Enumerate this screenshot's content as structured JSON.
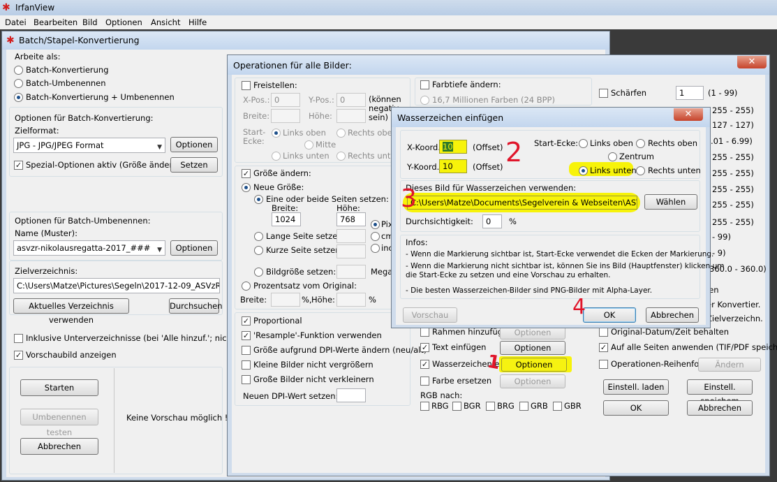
{
  "app": {
    "title": "IrfanView",
    "menu": [
      "Datei",
      "Bearbeiten",
      "Bild",
      "Optionen",
      "Ansicht",
      "Hilfe"
    ]
  },
  "batch": {
    "title": "Batch/Stapel-Konvertierung",
    "work_as_label": "Arbeite als:",
    "modes": [
      "Batch-Konvertierung",
      "Batch-Umbenennen",
      "Batch-Konvertierung + Umbenennen"
    ],
    "convert_options_label": "Optionen für Batch-Konvertierung:",
    "target_format_label": "Zielformat:",
    "target_format_value": "JPG - JPG/JPEG Format",
    "options_btn": "Optionen",
    "special_options_label": "Spezial-Optionen aktiv (Größe ändern etc.)",
    "set_btn": "Setzen",
    "rename_options_label": "Optionen für Batch-Umbenennen:",
    "name_pattern_label": "Name (Muster):",
    "name_pattern_value": "asvzr-nikolausregatta-2017_###",
    "target_dir_label": "Zielverzeichnis:",
    "target_dir_value": "C:\\Users\\Matze\\Pictures\\Segeln\\2017-12-09_ASVzR Nikola",
    "use_current_dir_btn": "Aktuelles Verzeichnis verwenden",
    "browse_btn": "Durchsuchen",
    "include_subdirs_label": "Inklusive Unterverzeichnisse (bei 'Alle hinzuf.'; nicht gesp.)",
    "show_preview_label": "Vorschaubild anzeigen",
    "start_btn": "Starten",
    "test_rename_btn": "Umbenennen testen",
    "cancel_btn": "Abbrechen",
    "no_preview": "Keine Vorschau möglich !"
  },
  "ops": {
    "title": "Operationen für alle Bilder:",
    "crop_label": "Freistellen:",
    "xpos_label": "X-Pos.:",
    "xpos_value": "0",
    "ypos_label": "Y-Pos.:",
    "ypos_value": "0",
    "negative_note": "(können negativ sein)",
    "width_label": "Breite:",
    "height_label": "Höhe:",
    "start_corner_label": "Start-Ecke:",
    "corner_top_left": "Links oben",
    "corner_top_right": "Rechts oben",
    "corner_center": "Mitte",
    "corner_bottom_left": "Links unten",
    "corner_bottom_right": "Rechts unten",
    "resize_label": "Größe ändern:",
    "new_size_label": "Neue Größe:",
    "one_or_both_label": "Eine oder beide Seiten setzen:",
    "rs_width_label": "Breite:",
    "rs_height_label": "Höhe:",
    "rs_width_value": "1024",
    "rs_height_value": "768",
    "unit_pixel": "Pix",
    "unit_cm": "cm",
    "unit_inch": "inc",
    "long_side_label": "Lange Seite setzen:",
    "short_side_label": "Kurze Seite setzen:",
    "image_size_label": "Bildgröße setzen:",
    "mega_label": "Mega",
    "percent_label": "Prozentsatz vom Original:",
    "pct_width_label": "Breite:",
    "pct_height_label": "Höhe:",
    "pct_sign": "%,",
    "pct_sign2": "%",
    "proportional_label": "Proportional",
    "resample_label": "'Resample'-Funktion verwenden",
    "dpi_change_label": "Größe aufgrund DPI-Werte ändern (neu/alt)",
    "no_enlarge_label": "Kleine Bilder nicht vergrößern",
    "no_shrink_label": "Große Bilder nicht verkleinern",
    "new_dpi_label": "Neuen DPI-Wert setzen:",
    "color_depth_label": "Farbtiefe ändern:",
    "color_16m": "16,7 Millionen Farben (24 BPP)",
    "add_frame_label": "Rahmen hinzufügen",
    "insert_text_label": "Text einfügen",
    "watermark_label": "Wasserzeichen einf.",
    "replace_color_label": "Farbe ersetzen",
    "options_btn": "Optionen",
    "rgb_label": "RGB nach:",
    "rgb_options": [
      "RBG",
      "BGR",
      "BRG",
      "GRB",
      "GBR"
    ],
    "sharpen_label": "Schärfen",
    "sharpen_value": "1",
    "sharpen_range": "(1 - 99)",
    "ranges": [
      "255 - 255)",
      "127 - 127)",
      ".01 - 6.99)",
      "255 - 255)",
      "255 - 255)",
      "255 - 255)",
      "255 - 255)",
      "255 - 255)",
      "- 99)",
      "- 9)",
      "360.0 - 360.0)"
    ],
    "right_labels": [
      "ien",
      "er Konvertier.",
      "Zielverzeichn."
    ],
    "orig_date_label": "Original-Datum/Zeit behalten",
    "all_pages_label": "Auf alle Seiten anwenden (TIF/PDF speichem)",
    "op_order_label": "Operationen-Reihenfolge",
    "change_btn": "Ändern",
    "load_settings_btn": "Einstell. laden",
    "save_settings_btn": "Einstell. speichem",
    "ok_btn": "OK",
    "cancel_btn": "Abbrechen"
  },
  "wm": {
    "title": "Wasserzeichen einfügen",
    "x_label": "X-Koord.:",
    "x_value": "10",
    "y_label": "Y-Koord.:",
    "y_value": "10",
    "offset_label": "(Offset)",
    "start_corner_label": "Start-Ecke:",
    "top_left": "Links oben",
    "top_right": "Rechts oben",
    "center": "Zentrum",
    "bottom_left": "Links unten",
    "bottom_right": "Rechts unten",
    "use_image_label": "Dieses Bild für Wasserzeichen verwenden:",
    "image_path": "C:\\Users\\Matze\\Documents\\Segelverein & Webseiten\\ASVzR\\ASVz",
    "choose_btn": "Wählen",
    "transparency_label": "Durchsichtigkeit:",
    "transparency_value": "0",
    "transparency_unit": "%",
    "infos_label": "Infos:",
    "info_1": "- Wenn die Markierung sichtbar ist, Start-Ecke verwendet die Ecken der Markierung.",
    "info_2": "- Wenn die Markierung nicht sichtbar ist, können Sie ins Bild (Hauptfenster) klicken um",
    "info_3": "  die Start-Ecke zu setzen und eine Vorschau zu erhalten.",
    "info_4": "- Die besten Wasserzeichen-Bilder sind PNG-Bilder mit Alpha-Layer.",
    "preview_btn": "Vorschau",
    "ok_btn": "OK",
    "cancel_btn": "Abbrechen"
  },
  "annotations": {
    "n1": "1",
    "n2": "2",
    "n3": "3",
    "n4": "4"
  },
  "colors": {
    "highlight": "#f7f30a",
    "pen": "#e0152a",
    "close": "#c6432b"
  }
}
